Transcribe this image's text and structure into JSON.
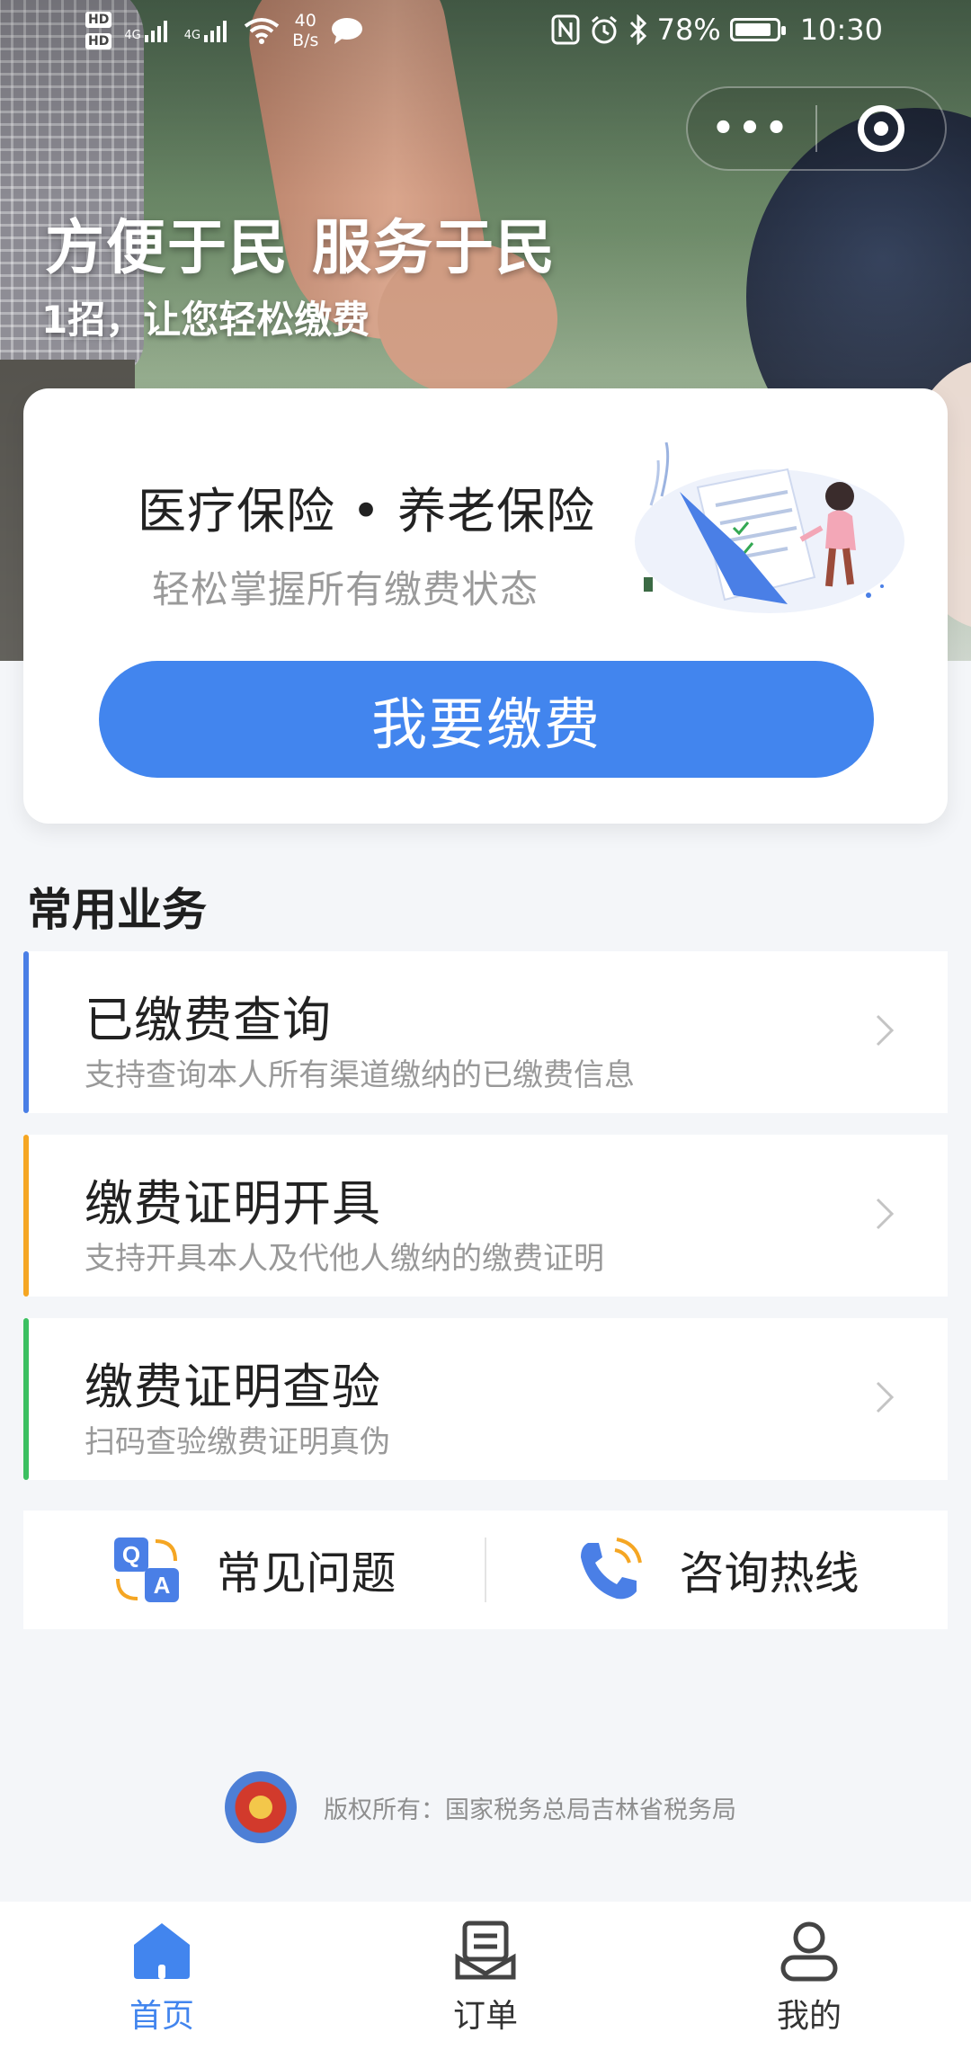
{
  "status_bar": {
    "network_speed_value": "40",
    "network_speed_unit": "B/s",
    "battery": "78%",
    "battery_level": 0.78,
    "time": "10:30",
    "signal_1": "4G",
    "signal_2": "4G",
    "hd1": "HD",
    "hd2": "HD"
  },
  "capsule": {
    "more_label": "•••"
  },
  "hero": {
    "title": "方便于民 服务于民",
    "subtitle": "1招，让您轻松缴费"
  },
  "main_card": {
    "title": "医疗保险 • 养老保险",
    "subtitle": "轻松掌握所有缴费状态",
    "button_label": "我要缴费"
  },
  "section": {
    "title": "常用业务"
  },
  "services": [
    {
      "title": "已缴费查询",
      "desc": "支持查询本人所有渠道缴纳的已缴费信息",
      "accent": "#4a7fe6"
    },
    {
      "title": "缴费证明开具",
      "desc": "支持开具本人及代他人缴纳的缴费证明",
      "accent": "#f5a623"
    },
    {
      "title": "缴费证明查验",
      "desc": "扫码查验缴费证明真伪",
      "accent": "#3cc061"
    }
  ],
  "help": {
    "faq_label": "常见问题",
    "hotline_label": "咨询热线"
  },
  "footer": {
    "copyright": "版权所有：国家税务总局吉林省税务局"
  },
  "tabs": [
    {
      "label": "首页",
      "icon": "home-icon",
      "active": true
    },
    {
      "label": "订单",
      "icon": "order-icon",
      "active": false
    },
    {
      "label": "我的",
      "icon": "user-icon",
      "active": false
    }
  ],
  "colors": {
    "primary": "#4285ee",
    "background": "#f4f6f9"
  }
}
